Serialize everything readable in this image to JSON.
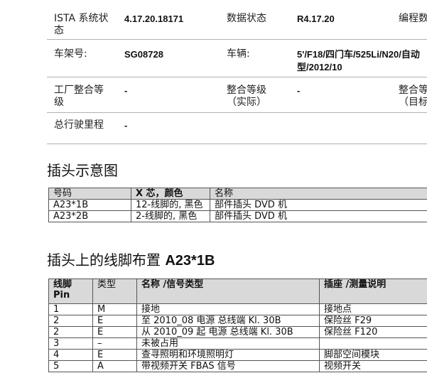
{
  "info": {
    "ista_label": "ISTA 系统状态",
    "ista_value": "4.17.20.18171",
    "data_status_label": "数据状态",
    "data_status_value": "R4.17.20",
    "programming_label": "编程数",
    "vin_label": "车架号:",
    "vin_value": "SG08728",
    "vehicle_label": "车辆:",
    "vehicle_value_line1": "5'/F18/四门车/525Li/N20/自动",
    "vehicle_value_line2": "型/2012/10",
    "factory_level_label": "工厂整合等级",
    "factory_level_value": "-",
    "actual_level_label": "整合等级（实际）",
    "actual_level_value": "-",
    "target_level_label_line1": "整合等",
    "target_level_label_line2": "（目标",
    "mileage_label": "总行驶里程",
    "mileage_value": "-"
  },
  "connector_section": {
    "title": "插头示意图",
    "headers": [
      "号码",
      "X 芯，颜色",
      "名称"
    ],
    "rows": [
      {
        "number": "A23*1B",
        "pins": "12-线脚的, 黑色",
        "name": "部件插头 DVD 机"
      },
      {
        "number": "A23*2B",
        "pins": "2-线脚的, 黑色",
        "name": "部件插头 DVD 机"
      }
    ]
  },
  "pin_section": {
    "title_prefix": "插头上的线脚布置",
    "title_connector": "A23*1B",
    "headers": {
      "pin": "线脚 Pin",
      "type": "类型",
      "name": "名称 /信号类型",
      "socket": "插座 /测量说明"
    },
    "rows": [
      {
        "pin": "1",
        "type": "M",
        "name": "接地",
        "socket": "接地点"
      },
      {
        "pin": "2",
        "type": "E",
        "name": "至 2010_08 电源 总线端 Kl. 30B",
        "socket": "保险丝 F29"
      },
      {
        "pin": "2",
        "type": "E",
        "name": "从 2010_09 起 电源 总线端 Kl. 30B",
        "socket": "保险丝 F120"
      },
      {
        "pin": "3",
        "type": "–",
        "name": "未被占用",
        "socket": ""
      },
      {
        "pin": "4",
        "type": "E",
        "name": "查寻照明和环境照明灯",
        "socket": "脚部空间模块"
      },
      {
        "pin": "5",
        "type": "A",
        "name": "带视频开关 FBAS 信号",
        "socket": "视频开关"
      }
    ]
  }
}
